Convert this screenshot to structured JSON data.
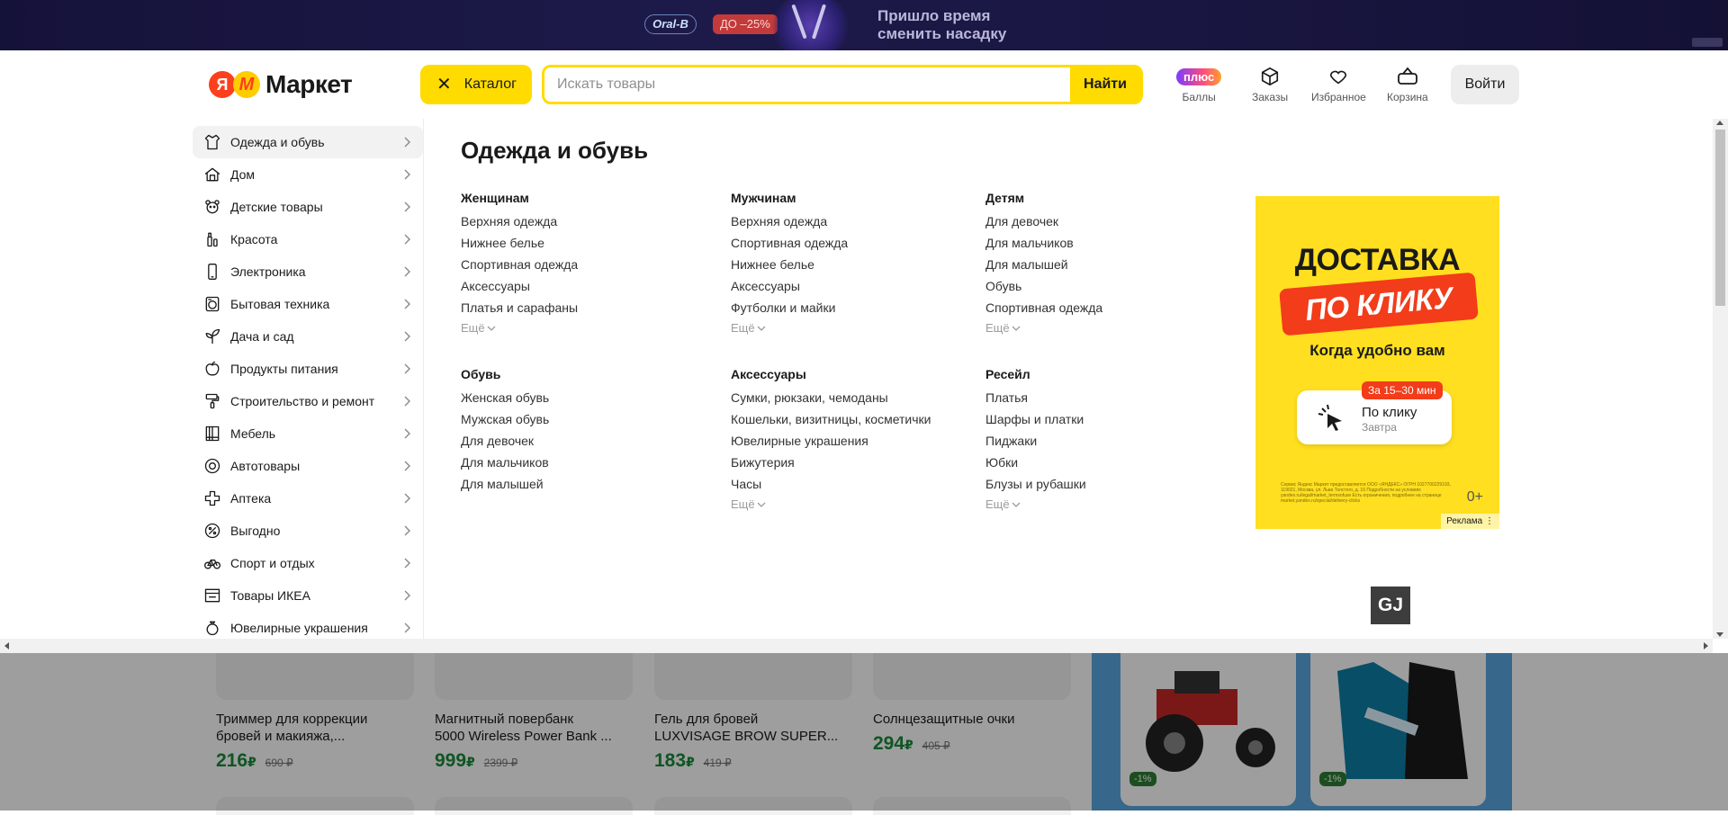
{
  "promo_banner": {
    "brand": "Oral-B",
    "discount": "ДО –25%",
    "headline_line1": "Пришло время",
    "headline_line2": "сменить насадку"
  },
  "header": {
    "logo_ya": "Я",
    "logo_m": "M",
    "logo_text": "Маркет",
    "catalog_label": "Каталог",
    "search_placeholder": "Искать товары",
    "search_button": "Найти",
    "plus_pill": "плюс",
    "points_label": "Баллы",
    "orders_label": "Заказы",
    "favorites_label": "Избранное",
    "cart_label": "Корзина",
    "login_label": "Войти"
  },
  "sidebar": {
    "items": [
      {
        "label": "Одежда и обувь",
        "icon": "clothes-icon"
      },
      {
        "label": "Дом",
        "icon": "home-icon"
      },
      {
        "label": "Детские товары",
        "icon": "bear-icon"
      },
      {
        "label": "Красота",
        "icon": "beauty-icon"
      },
      {
        "label": "Электроника",
        "icon": "phone-icon"
      },
      {
        "label": "Бытовая техника",
        "icon": "washer-icon"
      },
      {
        "label": "Дача и сад",
        "icon": "plant-icon"
      },
      {
        "label": "Продукты питания",
        "icon": "apple-icon"
      },
      {
        "label": "Строительство и ремонт",
        "icon": "roller-icon"
      },
      {
        "label": "Мебель",
        "icon": "wardrobe-icon"
      },
      {
        "label": "Автотовары",
        "icon": "wheel-icon"
      },
      {
        "label": "Аптека",
        "icon": "cross-icon"
      },
      {
        "label": "Выгодно",
        "icon": "percent-icon"
      },
      {
        "label": "Спорт и отдых",
        "icon": "bicycle-icon"
      },
      {
        "label": "Товары ИКЕА",
        "icon": "box-icon"
      },
      {
        "label": "Ювелирные украшения",
        "icon": "ring-icon"
      }
    ]
  },
  "catalog": {
    "title": "Одежда и обувь",
    "more_label": "Ещё",
    "groups": [
      {
        "title": "Женщинам",
        "links": [
          "Верхняя одежда",
          "Нижнее белье",
          "Спортивная одежда",
          "Аксессуары",
          "Платья и сарафаны"
        ],
        "more": true
      },
      {
        "title": "Мужчинам",
        "links": [
          "Верхняя одежда",
          "Спортивная одежда",
          "Нижнее белье",
          "Аксессуары",
          "Футболки и майки"
        ],
        "more": true
      },
      {
        "title": "Детям",
        "links": [
          "Для девочек",
          "Для мальчиков",
          "Для малышей",
          "Обувь",
          "Спортивная одежда"
        ],
        "more": true
      },
      {
        "title": "Обувь",
        "links": [
          "Женская обувь",
          "Мужская обувь",
          "Для девочек",
          "Для мальчиков",
          "Для малышей"
        ],
        "more": false
      },
      {
        "title": "Аксессуары",
        "links": [
          "Сумки, рюкзаки, чемоданы",
          "Кошельки, визитницы, косметички",
          "Ювелирные украшения",
          "Бижутерия",
          "Часы"
        ],
        "more": true
      },
      {
        "title": "Ресейл",
        "links": [
          "Платья",
          "Шарфы и платки",
          "Пиджаки",
          "Юбки",
          "Блузы и рубашки"
        ],
        "more": true
      }
    ]
  },
  "ad": {
    "line1": "ДОСТАВКА",
    "line2": "ПО КЛИКУ",
    "line3": "Когда удобно вам",
    "badge": "За 15–30 мин",
    "card_title": "По клику",
    "card_subtitle": "Завтра",
    "age": "0+",
    "mark": "Реклама ⋮",
    "legal": "Сервис Яндекс Маркет предоставляется ООО «ЯНДЕКС» ОГРН 1027700229193, 119021, Москва, ул. Льва Толстого, д. 16 Подробности на условиях yandex.ru/legal/market_termsofuse Есть ограничения, подробнее на странице market.yandex.ru/special/delivery-clicks"
  },
  "gj_badge": "GJ",
  "products": [
    {
      "name_line1": "Триммер для коррекции",
      "name_line2": "бровей и макияжа,...",
      "price": "216",
      "currency": "₽",
      "old_price": "690 ₽"
    },
    {
      "name_line1": "Магнитный повербанк",
      "name_line2": "5000 Wireless Power Bank ...",
      "price": "999",
      "currency": "₽",
      "old_price": "2399 ₽"
    },
    {
      "name_line1": "Гель для бровей",
      "name_line2": "LUXVISAGE BROW SUPER...",
      "price": "183",
      "currency": "₽",
      "old_price": "419 ₽"
    },
    {
      "name_line1": "Солнцезащитные очки",
      "name_line2": "",
      "price": "294",
      "currency": "₽",
      "old_price": "405 ₽"
    }
  ],
  "promo_cards": [
    {
      "discount": "-1%"
    },
    {
      "discount": "-1%"
    }
  ]
}
